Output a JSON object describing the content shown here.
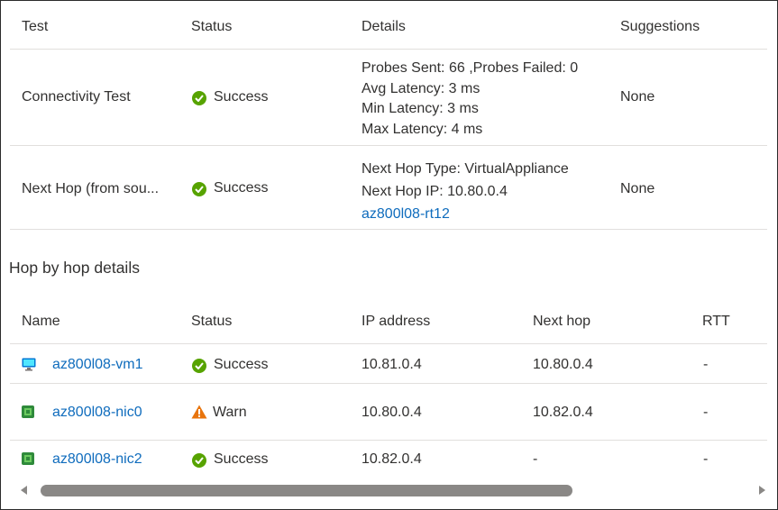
{
  "tests_table": {
    "headers": [
      "Test",
      "Status",
      "Details",
      "Suggestions"
    ],
    "rows": [
      {
        "test": "Connectivity Test",
        "status": "Success",
        "details": [
          "Probes Sent: 66 ,Probes Failed: 0",
          "Avg Latency: 3 ms",
          "Min Latency: 3 ms",
          "Max Latency: 4 ms"
        ],
        "suggestions": "None"
      },
      {
        "test": "Next Hop (from sou...",
        "status": "Success",
        "details": [
          "Next Hop Type: VirtualAppliance",
          "Next Hop IP: 10.80.0.4"
        ],
        "details_link": "az800l08-rt12",
        "suggestions": "None"
      }
    ]
  },
  "hop_section": {
    "title": "Hop by hop details",
    "headers": [
      "Name",
      "Status",
      "IP address",
      "Next hop",
      "RTT"
    ],
    "rows": [
      {
        "name": "az800l08-vm1",
        "icon": "virtual-machine-icon",
        "status": "Success",
        "status_icon": "success-check-icon",
        "ip": "10.81.0.4",
        "next_hop": "10.80.0.4",
        "rtt": "-"
      },
      {
        "name": "az800l08-nic0",
        "icon": "network-interface-icon",
        "status": "Warn",
        "status_icon": "warning-icon",
        "ip": "10.80.0.4",
        "next_hop": "10.82.0.4",
        "rtt": "-"
      },
      {
        "name": "az800l08-nic2",
        "icon": "network-interface-icon",
        "status": "Success",
        "status_icon": "success-check-icon",
        "ip": "10.82.0.4",
        "next_hop": "-",
        "rtt": "-"
      }
    ]
  },
  "colors": {
    "success": "#57a300",
    "warning": "#e8740c",
    "link": "#0f6cbd",
    "separator": "#e1dfdd"
  }
}
